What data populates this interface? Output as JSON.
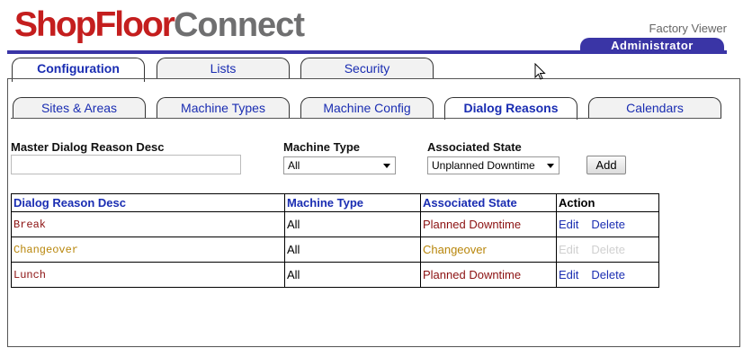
{
  "brand": {
    "part1": "ShopFloor",
    "part2": "Connect"
  },
  "header": {
    "app_title": "Factory Viewer",
    "role": "Administrator"
  },
  "top_tabs": [
    {
      "label": "Configuration",
      "active": true
    },
    {
      "label": "Lists",
      "active": false
    },
    {
      "label": "Security",
      "active": false
    }
  ],
  "sub_tabs": [
    {
      "label": "Sites & Areas",
      "active": false
    },
    {
      "label": "Machine Types",
      "active": false
    },
    {
      "label": "Machine Config",
      "active": false
    },
    {
      "label": "Dialog Reasons",
      "active": true
    },
    {
      "label": "Calendars",
      "active": false
    }
  ],
  "form": {
    "desc_label": "Master Dialog Reason Desc",
    "desc_value": "",
    "machine_type_label": "Machine Type",
    "machine_type_value": "All",
    "assoc_state_label": "Associated State",
    "assoc_state_value": "Unplanned Downtime",
    "add_label": "Add"
  },
  "table": {
    "headers": [
      "Dialog Reason Desc",
      "Machine Type",
      "Associated State",
      "Action"
    ],
    "rows": [
      {
        "desc": "Break",
        "machine_type": "All",
        "state": "Planned Downtime",
        "edit": "Edit",
        "delete": "Delete",
        "enabled": true,
        "state_color": "#8b1010"
      },
      {
        "desc": "Changeover",
        "machine_type": "All",
        "state": "Changeover",
        "edit": "Edit",
        "delete": "Delete",
        "enabled": false,
        "state_color": "#b8860b"
      },
      {
        "desc": "Lunch",
        "machine_type": "All",
        "state": "Planned Downtime",
        "edit": "Edit",
        "delete": "Delete",
        "enabled": true,
        "state_color": "#8b1010"
      }
    ]
  },
  "colors": {
    "brand_red": "#c41e1e",
    "brand_gray": "#6f6f70",
    "accent_blue": "#3a35a6",
    "link_blue": "#1a2db2"
  }
}
